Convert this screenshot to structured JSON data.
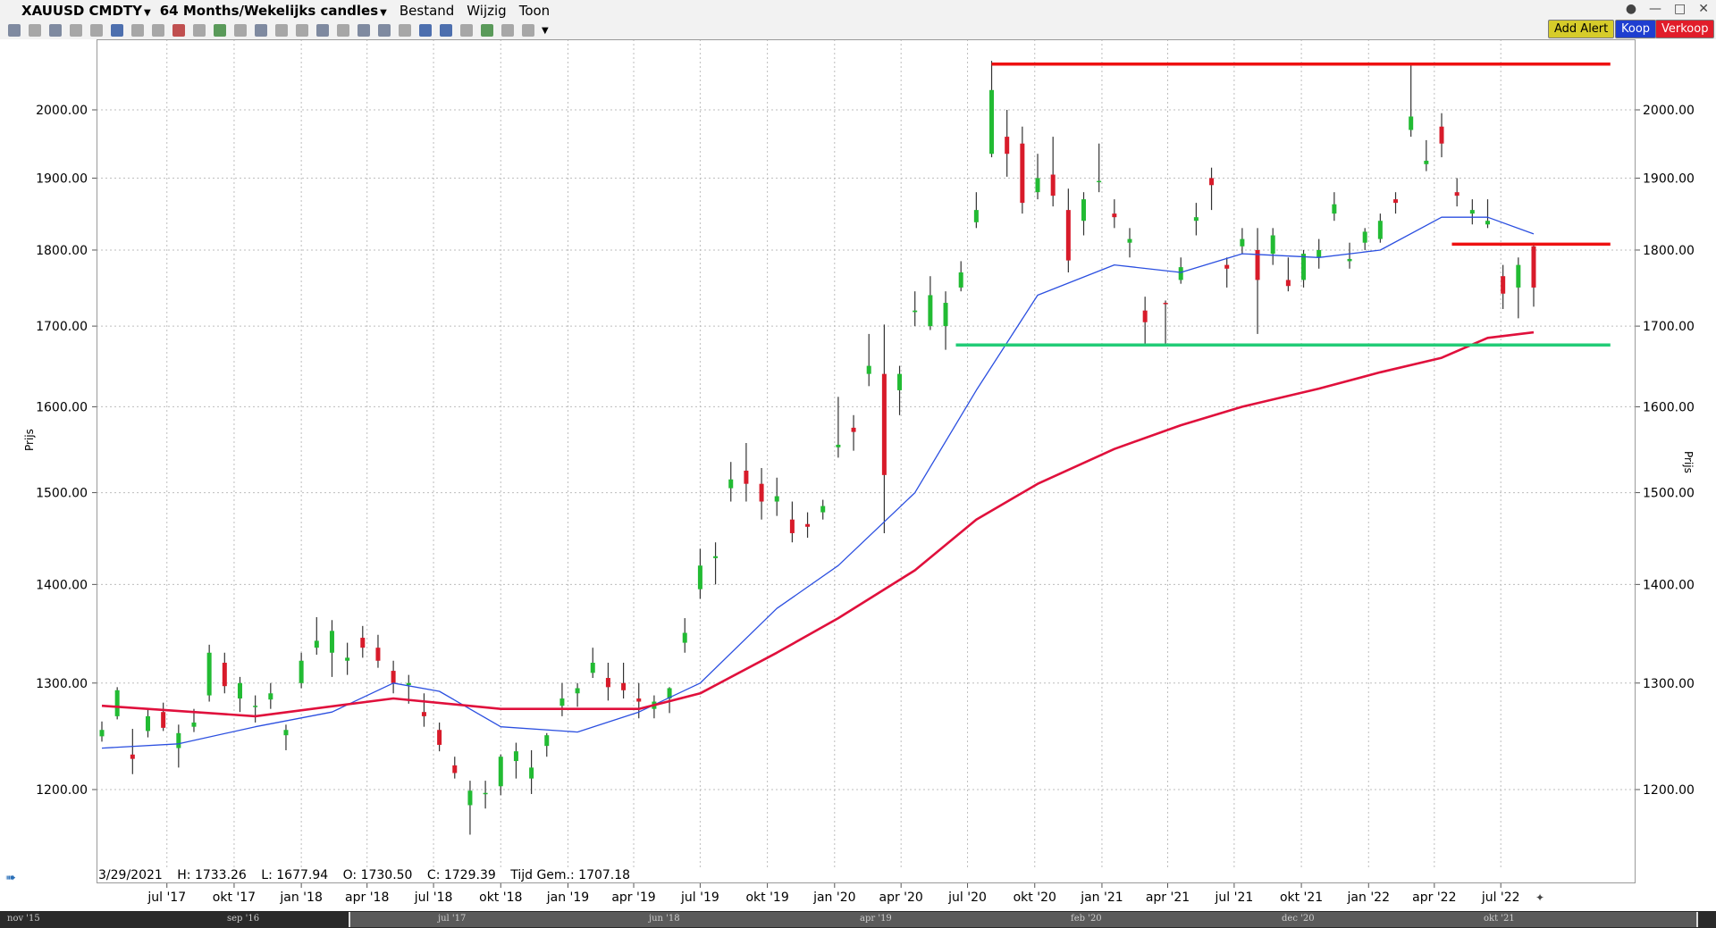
{
  "menubar": {
    "instrument": "XAUUSD CMDTY",
    "timeframe": "64 Months/Wekelijks candles",
    "menu": [
      "Bestand",
      "Wijzig",
      "Toon"
    ]
  },
  "buttons": {
    "alert": "Add Alert",
    "buy": "Koop",
    "sell": "Verkoop"
  },
  "info_bar": {
    "date": "3/29/2021",
    "high": "H: 1733.26",
    "low": "L: 1677.94",
    "open": "O: 1730.50",
    "close": "C: 1729.39",
    "avg": "Tijd Gem.: 1707.18"
  },
  "navigator": {
    "labels": [
      "nov '15",
      "sep '16",
      "jul '17",
      "jun '18",
      "apr '19",
      "feb '20",
      "dec '20",
      "okt '21"
    ]
  },
  "colors": {
    "candle_up": "#22bb33",
    "candle_down": "#d81b2a",
    "ma_short": "#2b4fe0",
    "ma_long": "#e0103c",
    "line_resistance": "#ee1111",
    "line_support": "#22cc77",
    "grid": "#bdbdbd"
  },
  "chart_data": {
    "type": "candlestick",
    "ylabel": "Prijs",
    "ylim": [
      1150,
      2080
    ],
    "y_scale": "log",
    "y_ticks": [
      "1200.00",
      "1300.00",
      "1400.00",
      "1500.00",
      "1600.00",
      "1700.00",
      "1800.00",
      "1900.00",
      "2000.00"
    ],
    "y_tick_values": [
      1200,
      1300,
      1400,
      1500,
      1600,
      1700,
      1800,
      1900,
      2000
    ],
    "x_ticks": [
      "jul '17",
      "okt '17",
      "jan '18",
      "apr '18",
      "jul '18",
      "okt '18",
      "jan '19",
      "apr '19",
      "jul '19",
      "okt '19",
      "jan '20",
      "apr '20",
      "jul '20",
      "okt '20",
      "jan '21",
      "apr '21",
      "jul '21",
      "okt '21",
      "jan '22",
      "apr '22",
      "jul '22"
    ],
    "grid": true,
    "series": [
      {
        "name": "",
        "kind": "ohlc",
        "points": [
          [
            "2017-04-03",
            1249,
            1263,
            1244,
            1255
          ],
          [
            "2017-04-24",
            1268,
            1296,
            1265,
            1293
          ],
          [
            "2017-05-15",
            1232,
            1256,
            1214,
            1228
          ],
          [
            "2017-06-05",
            1254,
            1275,
            1248,
            1268
          ],
          [
            "2017-06-26",
            1272,
            1281,
            1254,
            1257
          ],
          [
            "2017-07-17",
            1238,
            1260,
            1220,
            1252
          ],
          [
            "2017-08-07",
            1258,
            1275,
            1253,
            1262
          ],
          [
            "2017-08-28",
            1288,
            1338,
            1282,
            1330
          ],
          [
            "2017-09-18",
            1320,
            1330,
            1290,
            1297
          ],
          [
            "2017-10-09",
            1285,
            1306,
            1272,
            1300
          ],
          [
            "2017-10-30",
            1278,
            1288,
            1262,
            1278
          ],
          [
            "2017-11-20",
            1284,
            1300,
            1275,
            1290
          ],
          [
            "2017-12-11",
            1250,
            1260,
            1236,
            1255
          ],
          [
            "2018-01-01",
            1300,
            1330,
            1295,
            1322
          ],
          [
            "2018-01-22",
            1335,
            1366,
            1328,
            1342
          ],
          [
            "2018-02-12",
            1330,
            1363,
            1306,
            1352
          ],
          [
            "2018-03-05",
            1322,
            1340,
            1308,
            1325
          ],
          [
            "2018-03-26",
            1345,
            1357,
            1325,
            1335
          ],
          [
            "2018-04-16",
            1335,
            1348,
            1315,
            1322
          ],
          [
            "2018-05-07",
            1312,
            1322,
            1290,
            1300
          ],
          [
            "2018-05-28",
            1298,
            1308,
            1280,
            1300
          ],
          [
            "2018-06-18",
            1272,
            1290,
            1258,
            1268
          ],
          [
            "2018-07-09",
            1255,
            1262,
            1235,
            1241
          ],
          [
            "2018-07-30",
            1222,
            1230,
            1210,
            1215
          ],
          [
            "2018-08-20",
            1186,
            1208,
            1160,
            1199
          ],
          [
            "2018-09-10",
            1196,
            1208,
            1183,
            1197
          ],
          [
            "2018-10-01",
            1203,
            1232,
            1195,
            1230
          ],
          [
            "2018-10-22",
            1226,
            1243,
            1210,
            1235
          ],
          [
            "2018-11-12",
            1210,
            1236,
            1196,
            1220
          ],
          [
            "2018-12-03",
            1240,
            1252,
            1230,
            1250
          ],
          [
            "2018-12-24",
            1278,
            1300,
            1268,
            1285
          ],
          [
            "2019-01-14",
            1290,
            1300,
            1277,
            1295
          ],
          [
            "2019-02-04",
            1310,
            1335,
            1305,
            1320
          ],
          [
            "2019-02-25",
            1305,
            1320,
            1283,
            1296
          ],
          [
            "2019-03-18",
            1300,
            1320,
            1285,
            1293
          ],
          [
            "2019-04-08",
            1285,
            1300,
            1266,
            1282
          ],
          [
            "2019-04-29",
            1275,
            1288,
            1266,
            1282
          ],
          [
            "2019-05-20",
            1285,
            1296,
            1271,
            1295
          ],
          [
            "2019-06-10",
            1340,
            1365,
            1330,
            1350
          ],
          [
            "2019-07-01",
            1395,
            1438,
            1385,
            1420
          ],
          [
            "2019-07-22",
            1428,
            1445,
            1400,
            1430
          ],
          [
            "2019-08-12",
            1505,
            1535,
            1490,
            1515
          ],
          [
            "2019-09-02",
            1525,
            1557,
            1490,
            1510
          ],
          [
            "2019-09-23",
            1510,
            1528,
            1470,
            1490
          ],
          [
            "2019-10-14",
            1490,
            1517,
            1474,
            1496
          ],
          [
            "2019-11-04",
            1470,
            1490,
            1445,
            1455
          ],
          [
            "2019-11-25",
            1465,
            1478,
            1450,
            1462
          ],
          [
            "2019-12-16",
            1478,
            1492,
            1470,
            1485
          ],
          [
            "2020-01-06",
            1552,
            1612,
            1540,
            1555
          ],
          [
            "2020-01-27",
            1575,
            1590,
            1548,
            1570
          ],
          [
            "2020-02-17",
            1640,
            1690,
            1625,
            1650
          ],
          [
            "2020-03-09",
            1640,
            1702,
            1455,
            1520
          ],
          [
            "2020-03-30",
            1620,
            1650,
            1590,
            1640
          ],
          [
            "2020-04-20",
            1718,
            1745,
            1700,
            1720
          ],
          [
            "2020-05-11",
            1700,
            1765,
            1695,
            1740
          ],
          [
            "2020-06-01",
            1700,
            1745,
            1670,
            1730
          ],
          [
            "2020-06-22",
            1750,
            1785,
            1745,
            1770
          ],
          [
            "2020-07-13",
            1838,
            1880,
            1830,
            1855
          ],
          [
            "2020-08-03",
            1935,
            2075,
            1930,
            2030
          ],
          [
            "2020-08-24",
            1960,
            2000,
            1902,
            1935
          ],
          [
            "2020-09-14",
            1950,
            1975,
            1850,
            1865
          ],
          [
            "2020-10-05",
            1880,
            1935,
            1870,
            1900
          ],
          [
            "2020-10-26",
            1905,
            1960,
            1860,
            1875
          ],
          [
            "2020-11-16",
            1855,
            1885,
            1770,
            1786
          ],
          [
            "2020-12-07",
            1840,
            1880,
            1820,
            1870
          ],
          [
            "2020-12-28",
            1895,
            1950,
            1880,
            1896
          ],
          [
            "2021-01-18",
            1850,
            1870,
            1830,
            1845
          ],
          [
            "2021-02-08",
            1810,
            1830,
            1790,
            1815
          ],
          [
            "2021-03-01",
            1720,
            1738,
            1676,
            1705
          ],
          [
            "2021-03-29",
            1730,
            1733,
            1678,
            1729
          ],
          [
            "2021-04-19",
            1760,
            1790,
            1755,
            1777
          ],
          [
            "2021-05-10",
            1840,
            1865,
            1820,
            1845
          ],
          [
            "2021-05-31",
            1900,
            1915,
            1855,
            1890
          ],
          [
            "2021-06-21",
            1780,
            1790,
            1750,
            1775
          ],
          [
            "2021-07-12",
            1805,
            1830,
            1795,
            1815
          ],
          [
            "2021-08-02",
            1800,
            1830,
            1690,
            1760
          ],
          [
            "2021-08-23",
            1795,
            1830,
            1780,
            1820
          ],
          [
            "2021-09-13",
            1760,
            1790,
            1745,
            1752
          ],
          [
            "2021-10-04",
            1760,
            1800,
            1750,
            1795
          ],
          [
            "2021-10-25",
            1790,
            1815,
            1775,
            1800
          ],
          [
            "2021-11-15",
            1850,
            1880,
            1840,
            1863
          ],
          [
            "2021-12-06",
            1785,
            1810,
            1775,
            1788
          ],
          [
            "2021-12-27",
            1810,
            1830,
            1800,
            1825
          ],
          [
            "2022-01-17",
            1815,
            1850,
            1810,
            1840
          ],
          [
            "2022-02-07",
            1870,
            1880,
            1850,
            1865
          ],
          [
            "2022-02-28",
            1970,
            2070,
            1960,
            1990
          ],
          [
            "2022-03-21",
            1920,
            1955,
            1910,
            1925
          ],
          [
            "2022-04-11",
            1975,
            1995,
            1930,
            1950
          ],
          [
            "2022-05-02",
            1880,
            1900,
            1860,
            1875
          ],
          [
            "2022-05-23",
            1850,
            1870,
            1835,
            1855
          ],
          [
            "2022-06-13",
            1835,
            1870,
            1830,
            1840
          ],
          [
            "2022-07-04",
            1765,
            1780,
            1722,
            1742
          ],
          [
            "2022-07-25",
            1750,
            1790,
            1710,
            1780
          ],
          [
            "2022-08-15",
            1805,
            1810,
            1725,
            1750
          ]
        ]
      },
      {
        "name": "",
        "kind": "line",
        "role": "ma_short",
        "points": [
          [
            "2017-04-03",
            1238
          ],
          [
            "2017-07-17",
            1242
          ],
          [
            "2017-10-30",
            1258
          ],
          [
            "2018-02-12",
            1272
          ],
          [
            "2018-05-07",
            1300
          ],
          [
            "2018-07-09",
            1292
          ],
          [
            "2018-10-01",
            1258
          ],
          [
            "2019-01-14",
            1253
          ],
          [
            "2019-04-08",
            1272
          ],
          [
            "2019-07-01",
            1300
          ],
          [
            "2019-10-14",
            1375
          ],
          [
            "2020-01-06",
            1420
          ],
          [
            "2020-04-20",
            1500
          ],
          [
            "2020-07-13",
            1620
          ],
          [
            "2020-10-05",
            1740
          ],
          [
            "2021-01-18",
            1780
          ],
          [
            "2021-04-19",
            1770
          ],
          [
            "2021-07-12",
            1795
          ],
          [
            "2021-10-25",
            1790
          ],
          [
            "2022-01-17",
            1800
          ],
          [
            "2022-04-11",
            1845
          ],
          [
            "2022-06-13",
            1845
          ],
          [
            "2022-08-15",
            1822
          ]
        ]
      },
      {
        "name": "",
        "kind": "line",
        "role": "ma_long",
        "points": [
          [
            "2017-04-03",
            1278
          ],
          [
            "2017-10-30",
            1268
          ],
          [
            "2018-05-07",
            1285
          ],
          [
            "2018-10-01",
            1275
          ],
          [
            "2019-04-08",
            1275
          ],
          [
            "2019-07-01",
            1290
          ],
          [
            "2019-10-14",
            1330
          ],
          [
            "2020-01-06",
            1365
          ],
          [
            "2020-04-20",
            1415
          ],
          [
            "2020-07-13",
            1470
          ],
          [
            "2020-10-05",
            1510
          ],
          [
            "2021-01-18",
            1550
          ],
          [
            "2021-04-19",
            1578
          ],
          [
            "2021-07-12",
            1600
          ],
          [
            "2021-10-25",
            1622
          ],
          [
            "2022-01-17",
            1642
          ],
          [
            "2022-04-11",
            1660
          ],
          [
            "2022-06-13",
            1685
          ],
          [
            "2022-08-15",
            1692
          ]
        ]
      },
      {
        "name": "",
        "kind": "hline",
        "role": "line_resistance",
        "points": [
          [
            "2020-08-03",
            2070
          ],
          [
            "2022-11-28",
            2070
          ]
        ]
      },
      {
        "name": "",
        "kind": "hline",
        "role": "line_resistance",
        "points": [
          [
            "2022-04-25",
            1808
          ],
          [
            "2022-11-28",
            1808
          ]
        ]
      },
      {
        "name": "",
        "kind": "hline",
        "role": "line_support",
        "points": [
          [
            "2020-06-15",
            1676
          ],
          [
            "2022-11-28",
            1676
          ]
        ]
      }
    ]
  }
}
